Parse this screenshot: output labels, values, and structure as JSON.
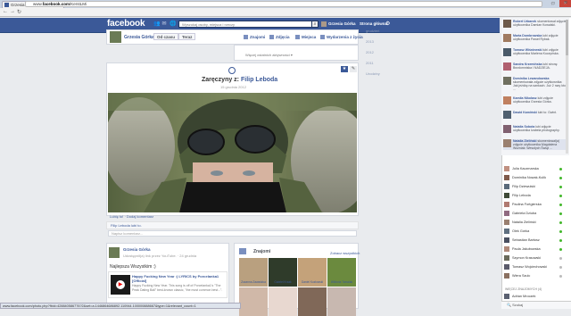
{
  "browser": {
    "tab_title": "Grzesia Górka",
    "url_prefix": "www.",
    "url_domain": "facebook.com",
    "url_path": "/KerstLMi",
    "window_buttons": [
      "–",
      "□",
      "×"
    ],
    "status_url": "www.facebook.com/photo.php?fbid=428840586776?2&set=a.1446864686892.110944.100000888667&type=1&relevant_count=1"
  },
  "fb_bar": {
    "logo": "facebook",
    "search_placeholder": "Wyszukaj osoby, miejsca i rzeczy",
    "user_name": "Grzesia Górka",
    "home_label": "Strona główna"
  },
  "profile_header": {
    "name": "Grzesia Górka",
    "friends_button": "Od czasu",
    "year_button": "Teraz",
    "nav": [
      "Znajomi",
      "Zdjęcia",
      "Miejsca",
      "Wydarzenia z życia"
    ]
  },
  "top_box": {
    "text": "Więcej ostatnich aktywności ▾"
  },
  "post": {
    "title_prefix": "Zaręczyny z:",
    "title_name": "Filip Leboda",
    "date": "15 grudnia 2012",
    "edit_icon": "✎",
    "actions": "Lubię to! · Dodaj komentarz",
    "likes": "Filip Leboda lubi to.",
    "comment_placeholder": "Napisz komentarz..."
  },
  "post2": {
    "name": "Grzesia Górka",
    "sub": "Udostępnił(a) link przez YouTube. · 24 grudnia",
    "text": "Najlepsza Wszystkim :)",
    "yt_title": "Happy Fucking New Year :) LYRICS by Porcelanka1 [Official]",
    "yt_desc": "Happy Fucking New Year. This song is off of Porcelanka1's \"The Peak Dating Ball\" best-known classic, \"the most common best...\"."
  },
  "friends_box": {
    "title": "Znajomi",
    "see_all": "Zobacz wszystkich",
    "friends": [
      {
        "name": "Zuzanna Zawadzka",
        "color": "#b9a07f"
      },
      {
        "name": "Gabriel Krzak",
        "color": "#2f3b2a"
      },
      {
        "name": "Daniel Kozłowski",
        "color": "#c4a27a"
      },
      {
        "name": "Wiktoria Tomalak",
        "color": "#6b8a3e"
      }
    ]
  },
  "left_nav": [
    "Teraz",
    "grudzień",
    "2013",
    "2012",
    "2011",
    "Urodziny"
  ],
  "ticker": [
    {
      "name": "Robert Urbanek",
      "text": "skomentował zdjęcie użytkownika Damian Kowalski.",
      "color": "#6d5a4a"
    },
    {
      "name": "Marta Dombrowska",
      "text": "lubi zdjęcie użytkownika Paweł Rybak.",
      "color": "#a07a60"
    },
    {
      "name": "Tomasz Wiśniewski",
      "text": "lubi zdjęcie użytkownika Marlena Kuczyńska.",
      "color": "#4a5a6a"
    },
    {
      "name": "Sandra Krzemińska",
      "text": "lubi stronę Bezdomniska I NADZIEJA.",
      "color": "#b06070"
    },
    {
      "name": "Dominika Lewandowska",
      "text": "skomentowała zdjęcie użytkownika: Jak jeżdżę na sankach. Już 2 razy ktoś ...",
      "color": "#707060"
    },
    {
      "name": "Kamila Nikolasz",
      "text": "lubi zdjęcie użytkownika Grzesia Górka.",
      "color": "#c08060"
    },
    {
      "name": "Dawid Kamiński",
      "text": "lubi to: Gwint.",
      "color": "#506070"
    },
    {
      "name": "Natalia Sobota",
      "text": "lubi zdjęcie użytkownika Izabela photography.",
      "color": "#806070"
    },
    {
      "name": "Natalia Zieliński",
      "text": "skomentował(a) zdjęcie użytkownika Magdalena Woźniak: Wesołych Świąt ...",
      "color": "#9a8070"
    }
  ],
  "chat": [
    {
      "name": "Julia Kaczmarska",
      "color": "#c09080",
      "online": true
    },
    {
      "name": "Dominika Nowak-Kulik",
      "color": "#805a4a",
      "online": true
    },
    {
      "name": "Filip Dziewulski",
      "color": "#5a6a7a",
      "online": true
    },
    {
      "name": "Filip Leboda",
      "color": "#3f4a37",
      "online": true
    },
    {
      "name": "Paulina Fortgierska",
      "color": "#b07a70",
      "online": true
    },
    {
      "name": "Gabriela Dziuba",
      "color": "#906a80",
      "online": true
    },
    {
      "name": "Natalia Zieliński",
      "color": "#9a8070",
      "online": true
    },
    {
      "name": "Olek Górka",
      "color": "#607080",
      "online": true
    },
    {
      "name": "Sebastian Bartosz",
      "color": "#4a5060",
      "online": true
    },
    {
      "name": "Paula Jakubowska",
      "color": "#b08a7a",
      "online": true
    },
    {
      "name": "Szymon Krasowski",
      "color": "#6a6a5a",
      "online": false
    },
    {
      "name": "Tomasz Wojciechowski",
      "color": "#5a5a6a",
      "online": false
    },
    {
      "name": "Wiera Szulc",
      "color": "#8a7060",
      "online": false
    }
  ],
  "chat_more": "WIĘCEJ ZNAJOMYCH (4)",
  "chat_last": {
    "name": "Adrian Mroczek",
    "color": "#5a6070"
  },
  "chat_search": "Szukaj"
}
